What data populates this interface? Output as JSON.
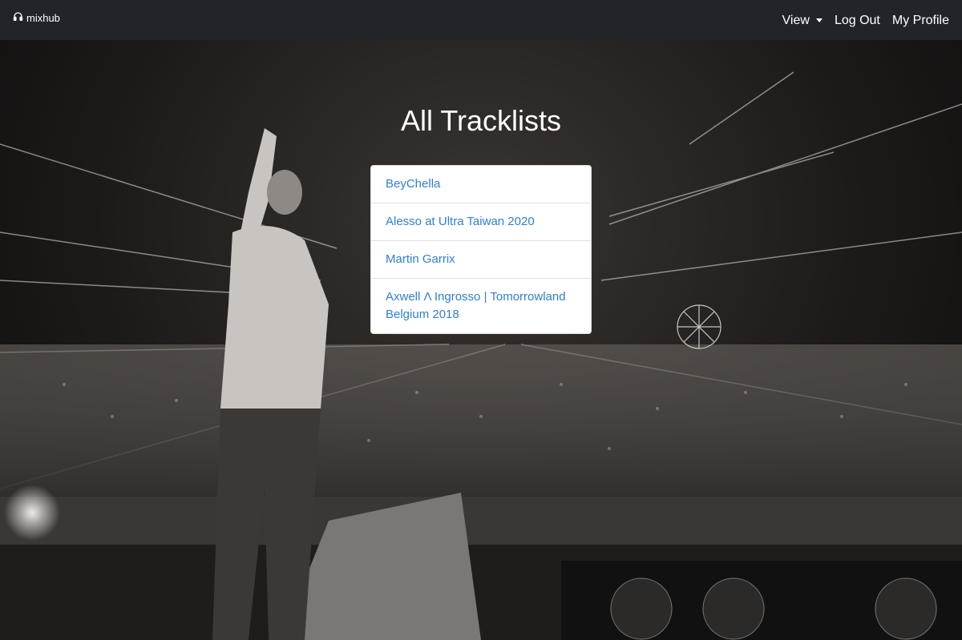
{
  "navbar": {
    "brand": "mixhub",
    "brand_icon": "headphones-icon",
    "links": {
      "view": "View",
      "logout": "Log Out",
      "profile": "My Profile"
    }
  },
  "page": {
    "title": "All Tracklists"
  },
  "tracklists": [
    {
      "name": "BeyChella"
    },
    {
      "name": "Alesso at Ultra Taiwan 2020"
    },
    {
      "name": "Martin Garrix"
    },
    {
      "name": "Axwell Λ Ingrosso | Tomorrowland Belgium 2018"
    }
  ],
  "colors": {
    "navbar_bg": "#212529",
    "link": "#2f7fd4"
  }
}
